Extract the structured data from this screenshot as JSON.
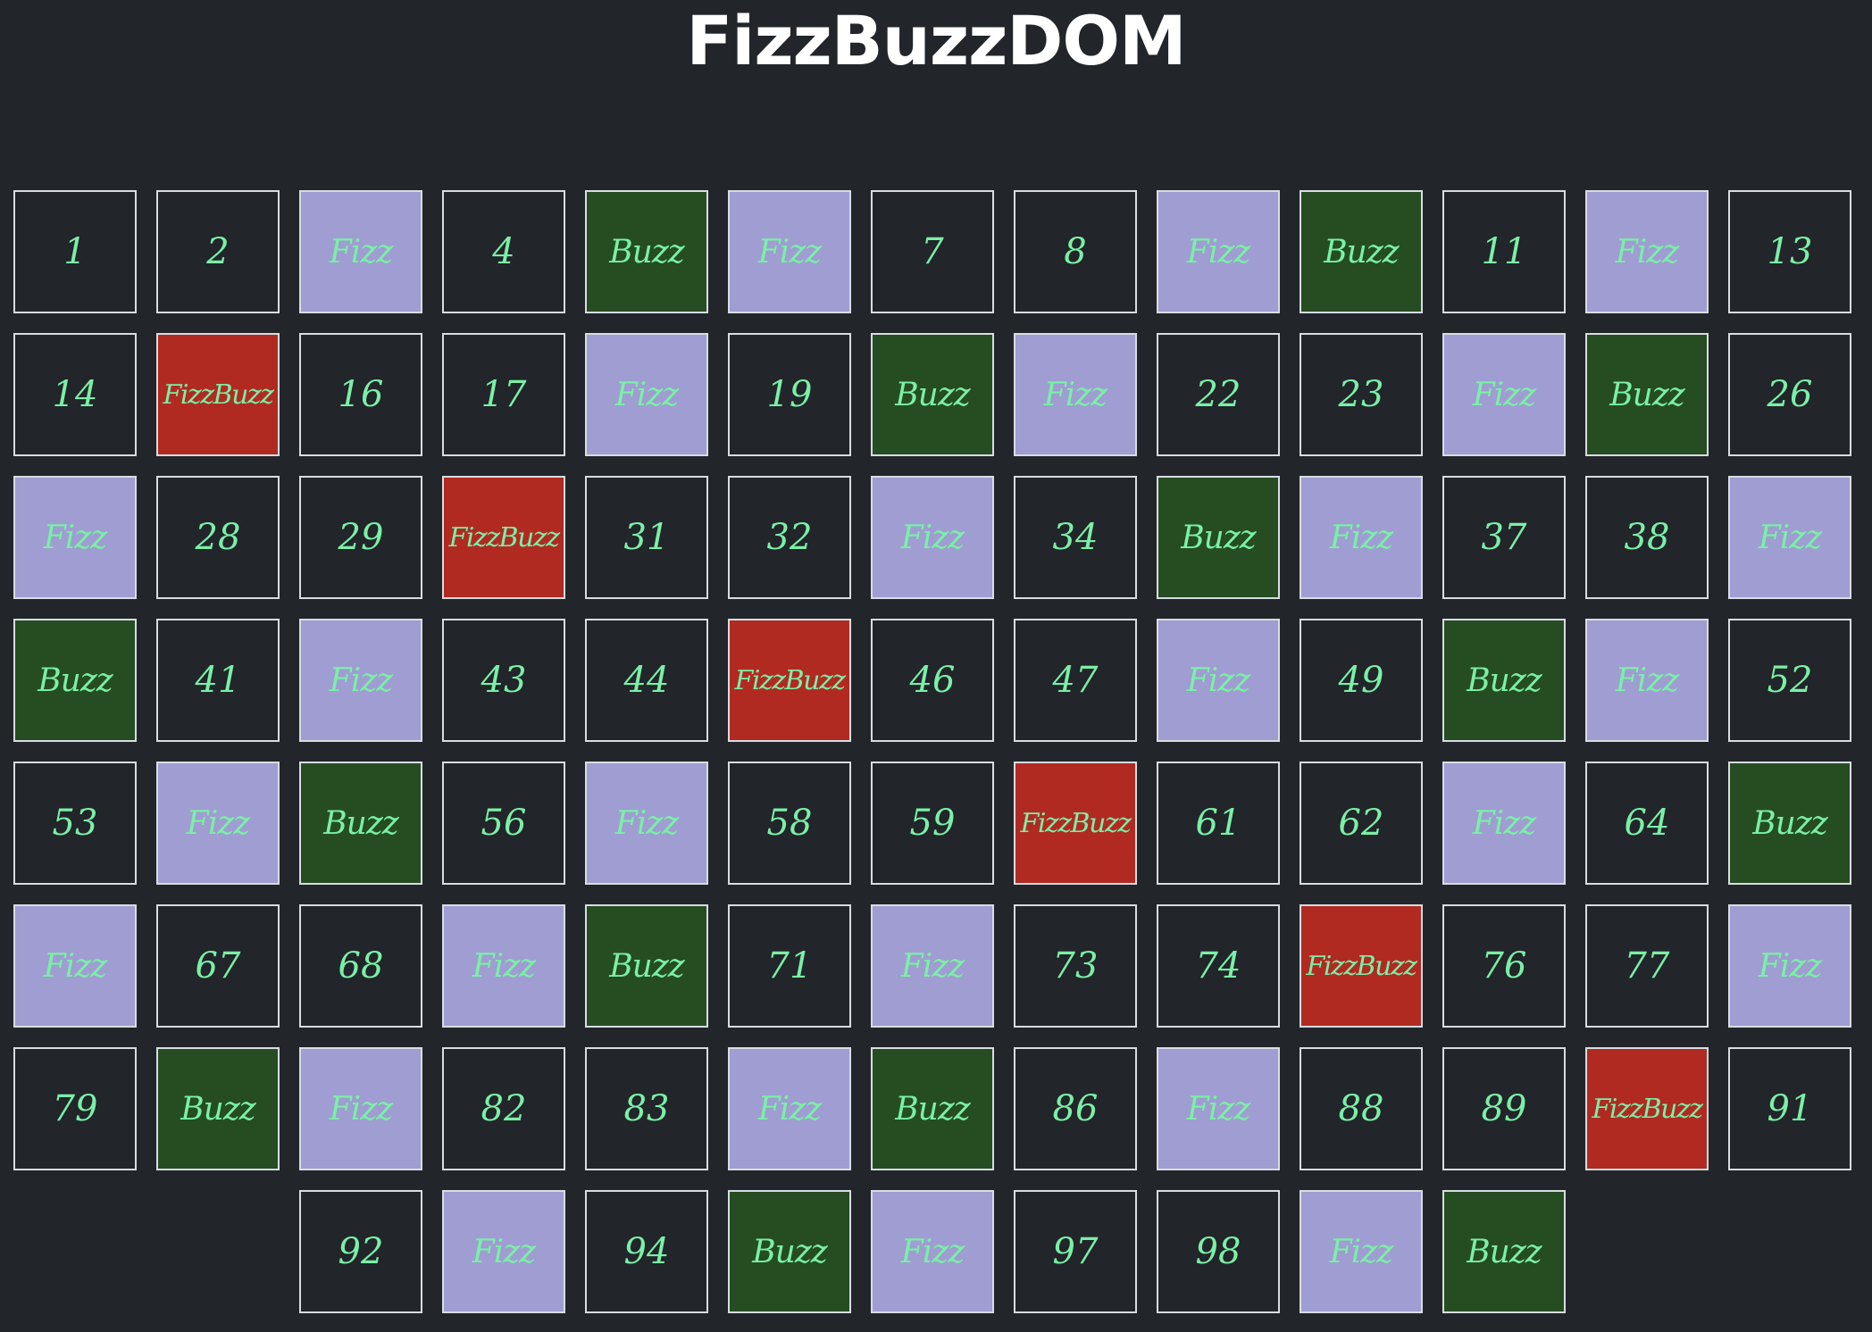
{
  "title": "FizzBuzzDOM",
  "colors": {
    "background": "#22252a",
    "text": "#7af0a6",
    "fizz": "#9f9dd2",
    "buzz": "#264d22",
    "fizzbuzz": "#b12a22",
    "border": "#d8dde2"
  },
  "cells": [
    {
      "label": "1",
      "kind": "number"
    },
    {
      "label": "2",
      "kind": "number"
    },
    {
      "label": "Fizz",
      "kind": "fizz"
    },
    {
      "label": "4",
      "kind": "number"
    },
    {
      "label": "Buzz",
      "kind": "buzz"
    },
    {
      "label": "Fizz",
      "kind": "fizz"
    },
    {
      "label": "7",
      "kind": "number"
    },
    {
      "label": "8",
      "kind": "number"
    },
    {
      "label": "Fizz",
      "kind": "fizz"
    },
    {
      "label": "Buzz",
      "kind": "buzz"
    },
    {
      "label": "11",
      "kind": "number"
    },
    {
      "label": "Fizz",
      "kind": "fizz"
    },
    {
      "label": "13",
      "kind": "number"
    },
    {
      "label": "14",
      "kind": "number"
    },
    {
      "label": "FizzBuzz",
      "kind": "fizzbuzz"
    },
    {
      "label": "16",
      "kind": "number"
    },
    {
      "label": "17",
      "kind": "number"
    },
    {
      "label": "Fizz",
      "kind": "fizz"
    },
    {
      "label": "19",
      "kind": "number"
    },
    {
      "label": "Buzz",
      "kind": "buzz"
    },
    {
      "label": "Fizz",
      "kind": "fizz"
    },
    {
      "label": "22",
      "kind": "number"
    },
    {
      "label": "23",
      "kind": "number"
    },
    {
      "label": "Fizz",
      "kind": "fizz"
    },
    {
      "label": "Buzz",
      "kind": "buzz"
    },
    {
      "label": "26",
      "kind": "number"
    },
    {
      "label": "Fizz",
      "kind": "fizz"
    },
    {
      "label": "28",
      "kind": "number"
    },
    {
      "label": "29",
      "kind": "number"
    },
    {
      "label": "FizzBuzz",
      "kind": "fizzbuzz"
    },
    {
      "label": "31",
      "kind": "number"
    },
    {
      "label": "32",
      "kind": "number"
    },
    {
      "label": "Fizz",
      "kind": "fizz"
    },
    {
      "label": "34",
      "kind": "number"
    },
    {
      "label": "Buzz",
      "kind": "buzz"
    },
    {
      "label": "Fizz",
      "kind": "fizz"
    },
    {
      "label": "37",
      "kind": "number"
    },
    {
      "label": "38",
      "kind": "number"
    },
    {
      "label": "Fizz",
      "kind": "fizz"
    },
    {
      "label": "Buzz",
      "kind": "buzz"
    },
    {
      "label": "41",
      "kind": "number"
    },
    {
      "label": "Fizz",
      "kind": "fizz"
    },
    {
      "label": "43",
      "kind": "number"
    },
    {
      "label": "44",
      "kind": "number"
    },
    {
      "label": "FizzBuzz",
      "kind": "fizzbuzz"
    },
    {
      "label": "46",
      "kind": "number"
    },
    {
      "label": "47",
      "kind": "number"
    },
    {
      "label": "Fizz",
      "kind": "fizz"
    },
    {
      "label": "49",
      "kind": "number"
    },
    {
      "label": "Buzz",
      "kind": "buzz"
    },
    {
      "label": "Fizz",
      "kind": "fizz"
    },
    {
      "label": "52",
      "kind": "number"
    },
    {
      "label": "53",
      "kind": "number"
    },
    {
      "label": "Fizz",
      "kind": "fizz"
    },
    {
      "label": "Buzz",
      "kind": "buzz"
    },
    {
      "label": "56",
      "kind": "number"
    },
    {
      "label": "Fizz",
      "kind": "fizz"
    },
    {
      "label": "58",
      "kind": "number"
    },
    {
      "label": "59",
      "kind": "number"
    },
    {
      "label": "FizzBuzz",
      "kind": "fizzbuzz"
    },
    {
      "label": "61",
      "kind": "number"
    },
    {
      "label": "62",
      "kind": "number"
    },
    {
      "label": "Fizz",
      "kind": "fizz"
    },
    {
      "label": "64",
      "kind": "number"
    },
    {
      "label": "Buzz",
      "kind": "buzz"
    },
    {
      "label": "Fizz",
      "kind": "fizz"
    },
    {
      "label": "67",
      "kind": "number"
    },
    {
      "label": "68",
      "kind": "number"
    },
    {
      "label": "Fizz",
      "kind": "fizz"
    },
    {
      "label": "Buzz",
      "kind": "buzz"
    },
    {
      "label": "71",
      "kind": "number"
    },
    {
      "label": "Fizz",
      "kind": "fizz"
    },
    {
      "label": "73",
      "kind": "number"
    },
    {
      "label": "74",
      "kind": "number"
    },
    {
      "label": "FizzBuzz",
      "kind": "fizzbuzz"
    },
    {
      "label": "76",
      "kind": "number"
    },
    {
      "label": "77",
      "kind": "number"
    },
    {
      "label": "Fizz",
      "kind": "fizz"
    },
    {
      "label": "79",
      "kind": "number"
    },
    {
      "label": "Buzz",
      "kind": "buzz"
    },
    {
      "label": "Fizz",
      "kind": "fizz"
    },
    {
      "label": "82",
      "kind": "number"
    },
    {
      "label": "83",
      "kind": "number"
    },
    {
      "label": "Fizz",
      "kind": "fizz"
    },
    {
      "label": "Buzz",
      "kind": "buzz"
    },
    {
      "label": "86",
      "kind": "number"
    },
    {
      "label": "Fizz",
      "kind": "fizz"
    },
    {
      "label": "88",
      "kind": "number"
    },
    {
      "label": "89",
      "kind": "number"
    },
    {
      "label": "FizzBuzz",
      "kind": "fizzbuzz"
    },
    {
      "label": "91",
      "kind": "number"
    },
    {
      "label": "92",
      "kind": "number"
    },
    {
      "label": "Fizz",
      "kind": "fizz"
    },
    {
      "label": "94",
      "kind": "number"
    },
    {
      "label": "Buzz",
      "kind": "buzz"
    },
    {
      "label": "Fizz",
      "kind": "fizz"
    },
    {
      "label": "97",
      "kind": "number"
    },
    {
      "label": "98",
      "kind": "number"
    },
    {
      "label": "Fizz",
      "kind": "fizz"
    },
    {
      "label": "Buzz",
      "kind": "buzz"
    }
  ]
}
